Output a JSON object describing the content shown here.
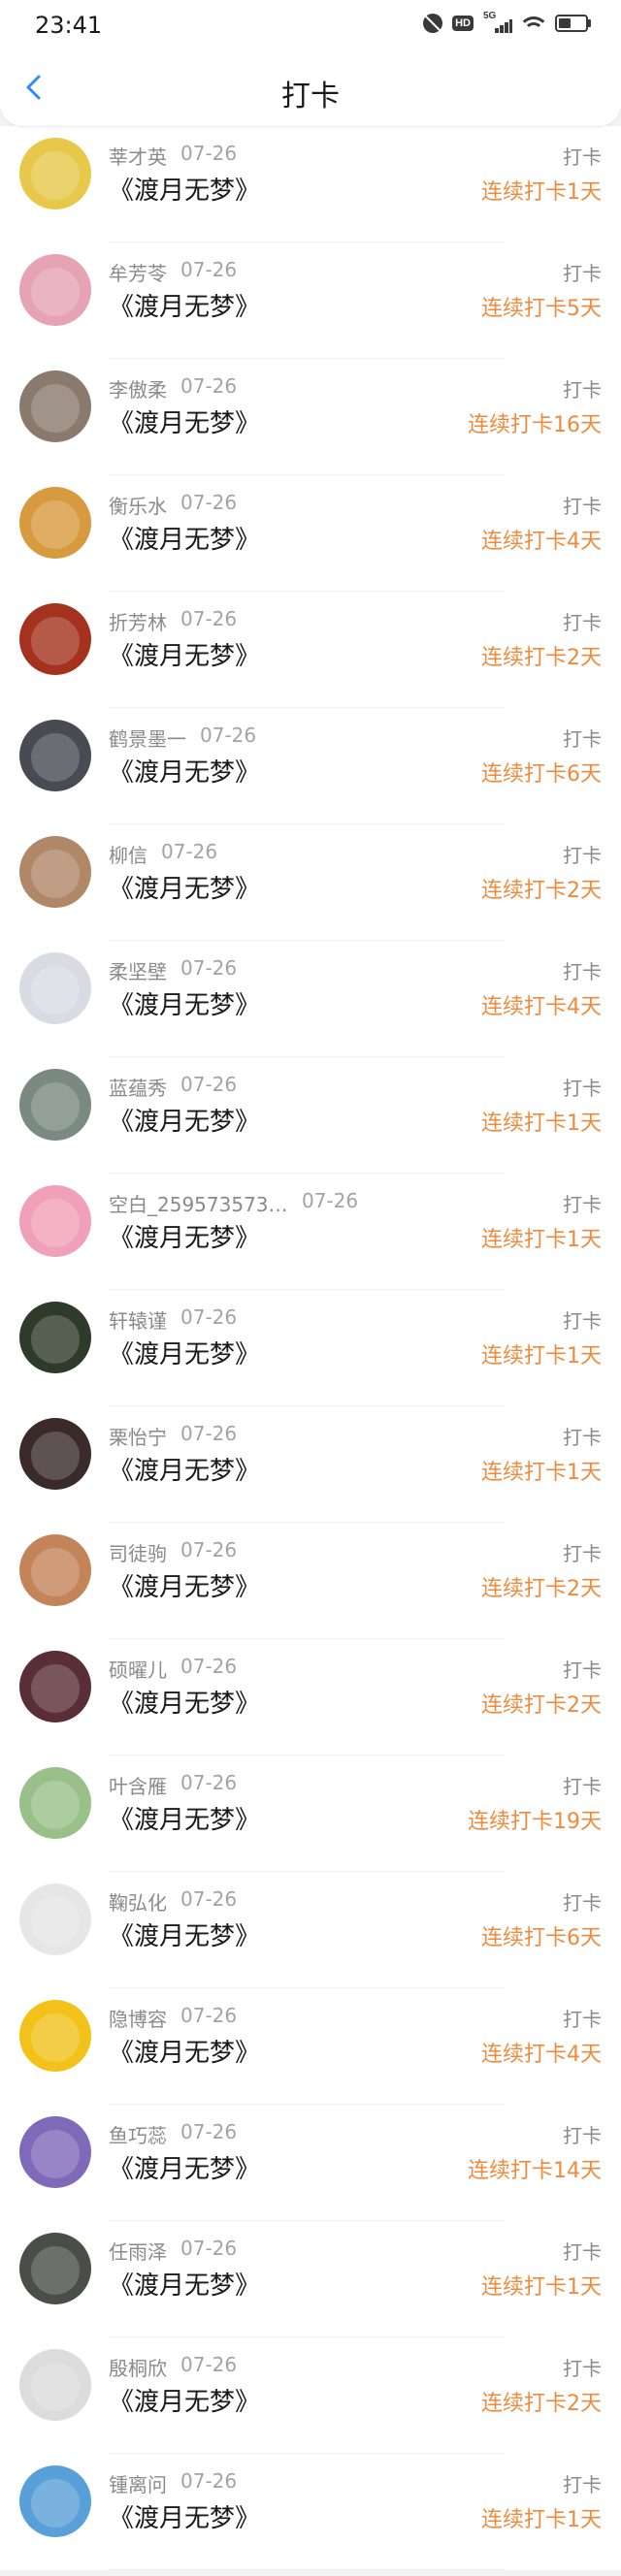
{
  "status_bar": {
    "time": "23:41",
    "icons": [
      "mute-bell-icon",
      "hd-icon",
      "5g-signal-icon",
      "wifi-icon",
      "battery-icon"
    ],
    "hd_label": "HD",
    "network_label": "5G",
    "battery_level": 0.45
  },
  "header": {
    "title": "打卡",
    "back_icon": "chevron-left-icon",
    "accent_color": "#2f8cf0"
  },
  "colors": {
    "streak": "#ef8a3c",
    "meta": "#8a8a8a"
  },
  "checkins": [
    {
      "name": "莘才英",
      "date": "07-26",
      "book": "《渡月无梦》",
      "tag": "打卡",
      "streak": "连续打卡1天",
      "avatar_color": "#e8c84a"
    },
    {
      "name": "牟芳苓",
      "date": "07-26",
      "book": "《渡月无梦》",
      "tag": "打卡",
      "streak": "连续打卡5天",
      "avatar_color": "#e6a3b4"
    },
    {
      "name": "李傲柔",
      "date": "07-26",
      "book": "《渡月无梦》",
      "tag": "打卡",
      "streak": "连续打卡16天",
      "avatar_color": "#8a7a6e"
    },
    {
      "name": "衡乐水",
      "date": "07-26",
      "book": "《渡月无梦》",
      "tag": "打卡",
      "streak": "连续打卡4天",
      "avatar_color": "#d89a3e"
    },
    {
      "name": "折芳林",
      "date": "07-26",
      "book": "《渡月无梦》",
      "tag": "打卡",
      "streak": "连续打卡2天",
      "avatar_color": "#a4321e"
    },
    {
      "name": "鹤景墨一",
      "date": "07-26",
      "book": "《渡月无梦》",
      "tag": "打卡",
      "streak": "连续打卡6天",
      "avatar_color": "#4a4a52"
    },
    {
      "name": "柳信",
      "date": "07-26",
      "book": "《渡月无梦》",
      "tag": "打卡",
      "streak": "连续打卡2天",
      "avatar_color": "#b08868"
    },
    {
      "name": "柔坚壁",
      "date": "07-26",
      "book": "《渡月无梦》",
      "tag": "打卡",
      "streak": "连续打卡4天",
      "avatar_color": "#d8dce2"
    },
    {
      "name": "蓝蕴秀",
      "date": "07-26",
      "book": "《渡月无梦》",
      "tag": "打卡",
      "streak": "连续打卡1天",
      "avatar_color": "#7a8a80"
    },
    {
      "name": "空白_259573573…",
      "date": "07-26",
      "book": "《渡月无梦》",
      "tag": "打卡",
      "streak": "连续打卡1天",
      "avatar_color": "#f0a0b8"
    },
    {
      "name": "轩辕谨",
      "date": "07-26",
      "book": "《渡月无梦》",
      "tag": "打卡",
      "streak": "连续打卡1天",
      "avatar_color": "#2e3a2a"
    },
    {
      "name": "栗怡宁",
      "date": "07-26",
      "book": "《渡月无梦》",
      "tag": "打卡",
      "streak": "连续打卡1天",
      "avatar_color": "#3a2a2a"
    },
    {
      "name": "司徒驹",
      "date": "07-26",
      "book": "《渡月无梦》",
      "tag": "打卡",
      "streak": "连续打卡2天",
      "avatar_color": "#c4845a"
    },
    {
      "name": "硕曜儿",
      "date": "07-26",
      "book": "《渡月无梦》",
      "tag": "打卡",
      "streak": "连续打卡2天",
      "avatar_color": "#5a2e36"
    },
    {
      "name": "叶含雁",
      "date": "07-26",
      "book": "《渡月无梦》",
      "tag": "打卡",
      "streak": "连续打卡19天",
      "avatar_color": "#9ac08a"
    },
    {
      "name": "鞠弘化",
      "date": "07-26",
      "book": "《渡月无梦》",
      "tag": "打卡",
      "streak": "连续打卡6天",
      "avatar_color": "#e6e6e6"
    },
    {
      "name": "隐博容",
      "date": "07-26",
      "book": "《渡月无梦》",
      "tag": "打卡",
      "streak": "连续打卡4天",
      "avatar_color": "#f2c21a"
    },
    {
      "name": "鱼巧蕊",
      "date": "07-26",
      "book": "《渡月无梦》",
      "tag": "打卡",
      "streak": "连续打卡14天",
      "avatar_color": "#7e6ab8"
    },
    {
      "name": "任雨泽",
      "date": "07-26",
      "book": "《渡月无梦》",
      "tag": "打卡",
      "streak": "连续打卡1天",
      "avatar_color": "#4a4e48"
    },
    {
      "name": "殷桐欣",
      "date": "07-26",
      "book": "《渡月无梦》",
      "tag": "打卡",
      "streak": "连续打卡2天",
      "avatar_color": "#dcdcdc"
    },
    {
      "name": "锺离问",
      "date": "07-26",
      "book": "《渡月无梦》",
      "tag": "打卡",
      "streak": "连续打卡1天",
      "avatar_color": "#5aa0d8"
    }
  ]
}
